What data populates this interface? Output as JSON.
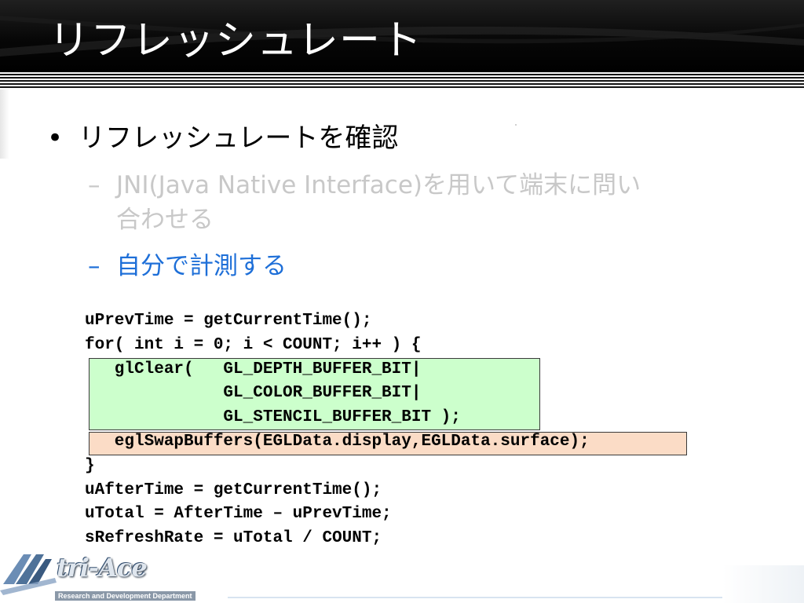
{
  "slide": {
    "title": "リフレッシュレート",
    "bullet": {
      "marker": "•",
      "text": "リフレッシュレートを確認"
    },
    "sub_items": [
      {
        "marker": "–",
        "line1": "JNI(Java Native Interface)を用いて端末に問い",
        "line2": "合わせる",
        "color": "#c8c8c8"
      },
      {
        "marker": "–",
        "line1": "自分で計測する",
        "color": "#1e6fd8"
      }
    ],
    "code_lines": [
      "uPrevTime = getCurrentTime();",
      "for( int i = 0; i < COUNT; i++ ) {",
      "   glClear(   GL_DEPTH_BUFFER_BIT|",
      "              GL_COLOR_BUFFER_BIT|",
      "              GL_STENCIL_BUFFER_BIT );",
      "   eglSwapBuffers(EGLData.display,EGLData.surface);",
      "}",
      "uAfterTime = getCurrentTime();",
      "uTotal = AfterTime – uPrevTime;",
      "sRefreshRate = uTotal / COUNT;"
    ],
    "highlight_colors": {
      "gl_clear_block": "#ccffcc",
      "swap_buffers_line": "#fbdcc6"
    }
  },
  "logo": {
    "name": "tri-Ace",
    "subtitle": "Research and Development Department",
    "icon": "tri-ace-logo-icon"
  }
}
